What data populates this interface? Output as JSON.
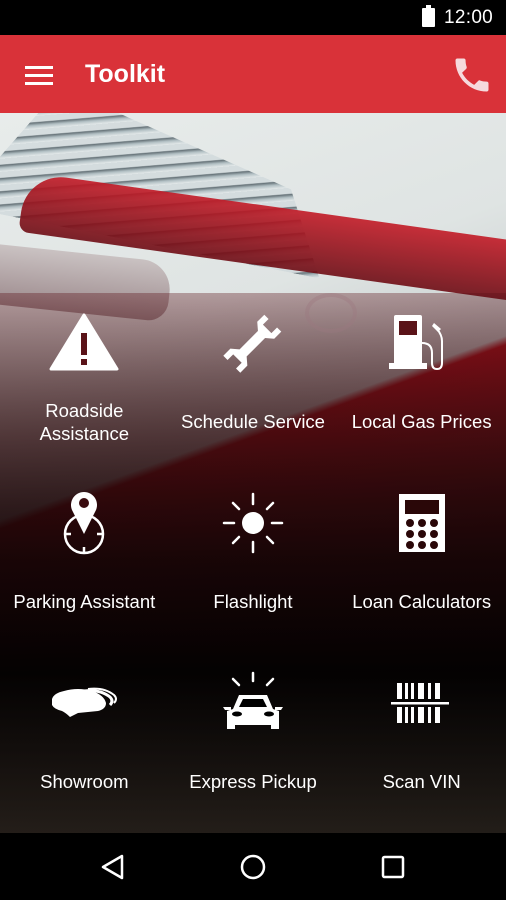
{
  "status_bar": {
    "time": "12:00",
    "battery_icon": "battery-full-icon"
  },
  "app_bar": {
    "menu_icon": "hamburger-menu-icon",
    "title": "Toolkit",
    "call_icon": "phone-icon",
    "color": "#d93239"
  },
  "toolkit": {
    "items": [
      {
        "label": "Roadside\nAssistance",
        "icon": "warning-triangle-icon"
      },
      {
        "label": "Schedule Service",
        "icon": "wrench-icon"
      },
      {
        "label": "Local Gas Prices",
        "icon": "gas-pump-icon"
      },
      {
        "label": "Parking Assistant",
        "icon": "location-pin-target-icon"
      },
      {
        "label": "Flashlight",
        "icon": "sun-brightness-icon"
      },
      {
        "label": "Loan Calculators",
        "icon": "calculator-icon"
      },
      {
        "label": "Showroom",
        "icon": "stacked-cars-icon"
      },
      {
        "label": "Express Pickup",
        "icon": "car-flash-icon"
      },
      {
        "label": "Scan VIN",
        "icon": "barcode-scan-icon"
      }
    ]
  },
  "nav_bar": {
    "back_icon": "back-triangle-icon",
    "home_icon": "home-circle-icon",
    "recents_icon": "recents-square-icon"
  }
}
